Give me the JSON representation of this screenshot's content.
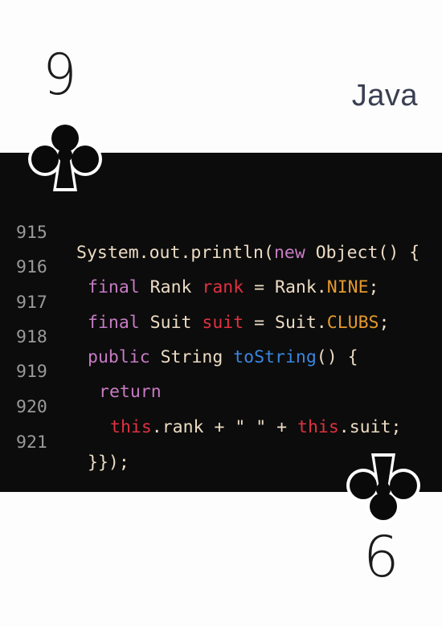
{
  "card": {
    "rank_top": "9",
    "rank_bottom": "6",
    "language": "Java",
    "suit_icon": "club-icon"
  },
  "colors": {
    "keyword": "#c77bc4",
    "variable": "#e0313f",
    "constant": "#e59a2c",
    "function": "#3a86e0",
    "plain": "#ecdcc4",
    "line_number": "#9a9a9a",
    "panel_background": "#0c0c0c"
  },
  "code": {
    "lines": [
      {
        "number": "915",
        "tokens": [
          {
            "text": "System.out.println(",
            "kind": "plain"
          },
          {
            "text": "new",
            "kind": "keyword"
          },
          {
            "text": " Object() {",
            "kind": "plain"
          }
        ]
      },
      {
        "number": "916",
        "tokens": [
          {
            "text": "final",
            "kind": "keyword"
          },
          {
            "text": " Rank ",
            "kind": "plain"
          },
          {
            "text": "rank",
            "kind": "variable"
          },
          {
            "text": " = Rank.",
            "kind": "plain"
          },
          {
            "text": "NINE",
            "kind": "constant"
          },
          {
            "text": ";",
            "kind": "plain"
          }
        ]
      },
      {
        "number": "917",
        "tokens": [
          {
            "text": "final",
            "kind": "keyword"
          },
          {
            "text": " Suit ",
            "kind": "plain"
          },
          {
            "text": "suit",
            "kind": "variable"
          },
          {
            "text": " = Suit.",
            "kind": "plain"
          },
          {
            "text": "CLUBS",
            "kind": "constant"
          },
          {
            "text": ";",
            "kind": "plain"
          }
        ]
      },
      {
        "number": "918",
        "tokens": [
          {
            "text": "public",
            "kind": "keyword"
          },
          {
            "text": " String ",
            "kind": "plain"
          },
          {
            "text": "toString",
            "kind": "function"
          },
          {
            "text": "() {",
            "kind": "plain"
          }
        ]
      },
      {
        "number": "919",
        "tokens": [
          {
            "text": "return",
            "kind": "keyword"
          }
        ]
      },
      {
        "number": "920",
        "tokens": [
          {
            "text": "this",
            "kind": "variable"
          },
          {
            "text": ".rank + \" \" + ",
            "kind": "plain"
          },
          {
            "text": "this",
            "kind": "variable"
          },
          {
            "text": ".suit;",
            "kind": "plain"
          }
        ]
      },
      {
        "number": "921",
        "tokens": [
          {
            "text": "}});",
            "kind": "plain"
          }
        ]
      }
    ]
  }
}
